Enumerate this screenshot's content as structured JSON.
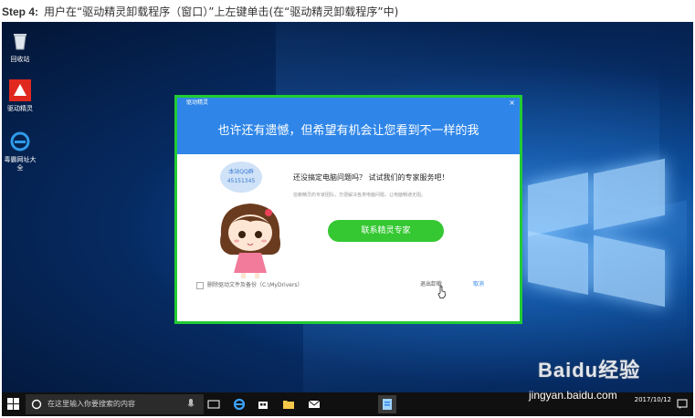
{
  "header": {
    "step_label": "Step 4:",
    "instruction": "用户在“驱动精灵卸载程序（窗口）”上左键单击(在“驱动精灵卸载程序”中)"
  },
  "desktop": {
    "icons": [
      {
        "name": "recycle-bin",
        "label": "回收站"
      },
      {
        "name": "drive-genius",
        "label": "驱动精灵"
      },
      {
        "name": "browser",
        "label": "毒霸网址大全"
      }
    ]
  },
  "dialog": {
    "title": "驱动精灵",
    "close_glyph": "×",
    "banner": "也许还有遗憾，但希望有机会让您看到不一样的我",
    "bubble_line1": "本站QQ群",
    "bubble_line2": "45151345",
    "question": "还没搞定电脑问题吗？ 试试我们的专家服务吧！",
    "subtext": "信赖精灵的专家团队，方便解决各类电脑问题，让电脑畅通无阻。",
    "contact_button": "联系精灵专家",
    "checkbox_label": "删除驱动文件及备份（C:\\MyDrivers）",
    "uninstall_link": "退出卸载",
    "cancel_link": "取消"
  },
  "taskbar": {
    "search_placeholder": "在这里输入你要搜索的内容",
    "date": "2017/10/12"
  },
  "watermark": {
    "brand": "Baidu经验",
    "url": "jingyan.baidu.com"
  },
  "colors": {
    "dialog_blue": "#2f86e8",
    "highlight_green": "#22cc33",
    "button_green": "#35c832"
  }
}
